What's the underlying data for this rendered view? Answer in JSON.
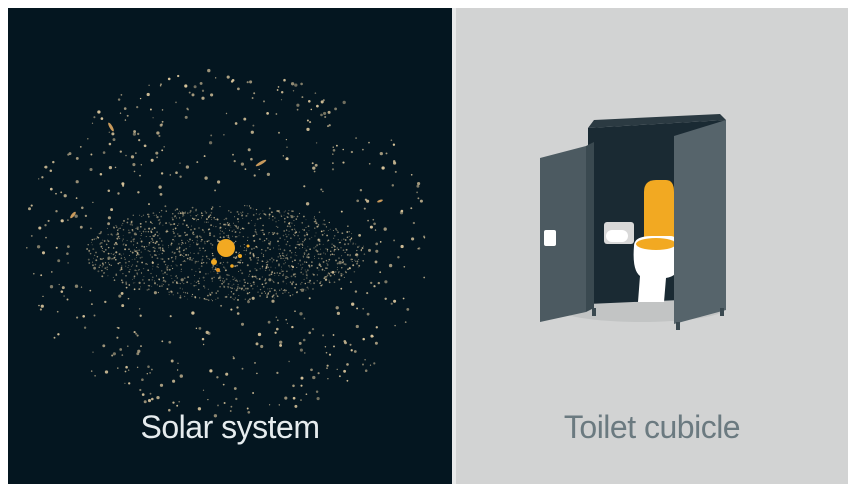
{
  "panels": [
    {
      "caption": "Solar system",
      "background": "#041620",
      "caption_color": "#e6ecee",
      "illustration": "solar-system-illustration"
    },
    {
      "caption": "Toilet cubicle",
      "background": "#d2d3d3",
      "caption_color": "#6b7a80",
      "illustration": "toilet-cubicle-illustration"
    }
  ],
  "colors": {
    "sun": "#f2a922",
    "dust": "#d9c59c",
    "cubicle_panel": "#4c5a61",
    "cubicle_dark": "#1a2a33",
    "toilet_seat": "#f2a922",
    "toilet_bowl": "#ffffff"
  }
}
